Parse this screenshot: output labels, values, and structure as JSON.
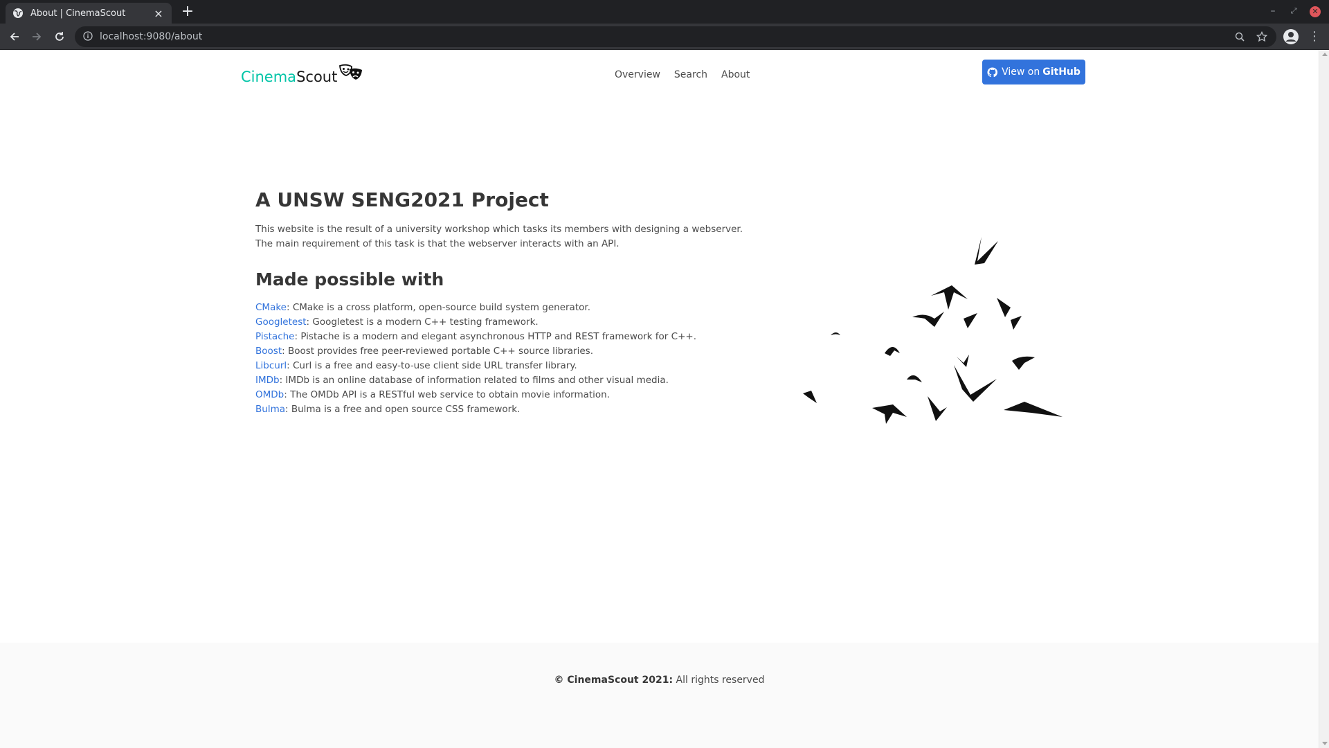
{
  "browser": {
    "tab_title": "About | CinemaScout",
    "tab_close": "×",
    "new_tab": "+",
    "url": "localhost:9080/about",
    "minimize": "–",
    "restore": "⤢",
    "close": "✕",
    "menu": "⋮"
  },
  "navbar": {
    "brand_cinema": "Cinema",
    "brand_scout": "Scout",
    "links": [
      "Overview",
      "Search",
      "About"
    ],
    "github_prefix": "View on",
    "github_bold": "GitHub",
    "github_color": "#3273dc",
    "brand_accent": "#00c4a7"
  },
  "content": {
    "title": "A UNSW SENG2021 Project",
    "description": "This website is the result of a university workshop which tasks its members with designing a webserver. The main requirement of this task is that the webserver interacts with an API.",
    "made_possible": "Made possible with",
    "credits": [
      {
        "name": "CMake",
        "text": ": CMake is a cross platform, open-source build system generator."
      },
      {
        "name": "Googletest",
        "text": ": Googletest is a modern C++ testing framework."
      },
      {
        "name": "Pistache",
        "text": ": Pistache is a modern and elegant asynchronous HTTP and REST framework for C++."
      },
      {
        "name": "Boost",
        "text": ": Boost provides free peer-reviewed portable C++ source libraries."
      },
      {
        "name": "Libcurl",
        "text": ": Curl is a free and easy-to-use client side URL transfer library."
      },
      {
        "name": "IMDb",
        "text": ": IMDb is an online database of information related to films and other visual media."
      },
      {
        "name": "OMDb",
        "text": ": The OMDb API is a RESTful web service to obtain movie information."
      },
      {
        "name": "Bulma",
        "text": ": Bulma is a free and open source CSS framework."
      }
    ],
    "link_color": "#3273dc"
  },
  "footer": {
    "copyright_bold": "© CinemaScout 2021:",
    "copyright_rest": " All rights reserved"
  }
}
